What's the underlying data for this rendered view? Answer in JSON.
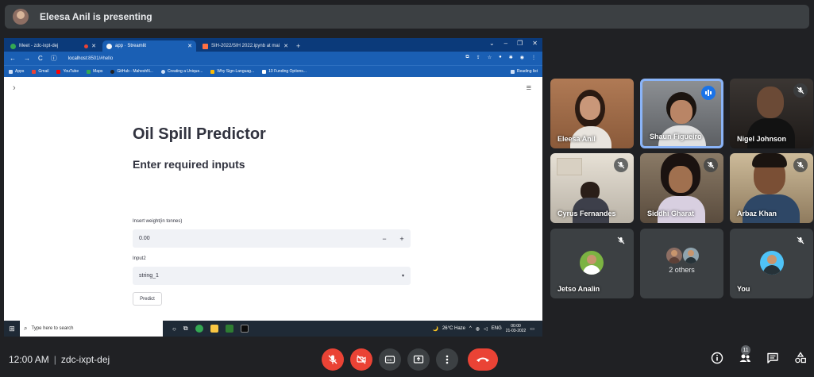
{
  "presenting": {
    "text": "Eleesa Anil is presenting"
  },
  "browser": {
    "tabs": [
      {
        "label": "Meet - zdc-ixpt-dej",
        "active": false
      },
      {
        "label": "app · Streamlit",
        "active": true
      },
      {
        "label": "SIH-2022/SIH 2022.ipynb at mai",
        "active": false
      }
    ],
    "new_tab": "+",
    "url_host": "localhost",
    "url_rest": ":8501/#hello",
    "bookmarks": [
      "Apps",
      "Gmail",
      "YouTube",
      "Maps",
      "GitHub - MaheshN...",
      "Creating a Unique...",
      "Why Sign-Languag...",
      "10 Funding Options..."
    ],
    "reading_list": "Reading list"
  },
  "app": {
    "title": "Oil Spill Predictor",
    "subtitle": "Enter required inputs",
    "weight_label": "Insert weight(in tonnes)",
    "weight_value": "0.00",
    "minus": "−",
    "plus": "+",
    "input2_label": "Input2",
    "input2_value": "string_1",
    "predict_label": "Predict"
  },
  "taskbar": {
    "search_placeholder": "Type here to search",
    "weather": "26°C  Haze",
    "lang": "ENG",
    "time": "00:00",
    "date": "21-03-2022"
  },
  "participants": [
    {
      "name": "Eleesa Anil",
      "mic": "none"
    },
    {
      "name": "Shaun Figueiro",
      "mic": "active"
    },
    {
      "name": "Nigel Johnson",
      "mic": "muted"
    },
    {
      "name": "Cyrus Fernandes",
      "mic": "muted"
    },
    {
      "name": "Siddhi Gharat",
      "mic": "muted"
    },
    {
      "name": "Arbaz Khan",
      "mic": "muted"
    },
    {
      "name": "Jetso Analin",
      "mic": "muted"
    },
    {
      "name": "2 others",
      "mic": "none"
    },
    {
      "name": "You",
      "mic": "muted"
    }
  ],
  "meeting": {
    "time": "12:00 AM",
    "separator": "|",
    "code": "zdc-ixpt-dej",
    "people_count": "11"
  },
  "colors": {
    "background": "#202124",
    "tile": "#3c4043",
    "accent_red": "#ea4335",
    "accent_blue": "#1a73e8",
    "browser_blue": "#1a5fb4"
  }
}
